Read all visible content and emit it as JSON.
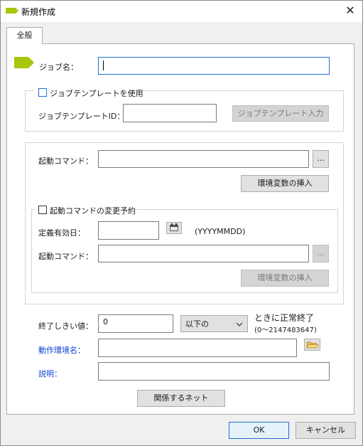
{
  "window": {
    "title": "新規作成",
    "close_symbol": "✕"
  },
  "tab": {
    "label": "全般"
  },
  "job_name": {
    "label": "ジョブ名：",
    "value": ""
  },
  "template": {
    "use_label": "ジョブテンプレートを使用",
    "id_label": "ジョブテンプレートID：",
    "id_value": "",
    "input_button": "ジョブテンプレート入力"
  },
  "start_command": {
    "label": "起動コマンド：",
    "value": "",
    "browse_label": "...",
    "insert_env_button": "環境変数の挿入"
  },
  "change_reservation": {
    "checkbox_label": "起動コマンドの変更予約",
    "date_label": "定義有効日：",
    "date_value": "",
    "date_format": "(YYYYMMDD)",
    "command_label": "起動コマンド：",
    "command_value": "",
    "browse_label": "...",
    "insert_env_button": "環境変数の挿入"
  },
  "end_threshold": {
    "label": "終了しきい値：",
    "value": "0",
    "condition_value": "以下の",
    "suffix": "ときに正常終了",
    "range": "(0〜2147483647)"
  },
  "environment": {
    "label": "動作環境名：",
    "value": ""
  },
  "description": {
    "label": "説明：",
    "value": ""
  },
  "related_net_button": "関係するネット",
  "footer": {
    "ok": "OK",
    "cancel": "キャンセル"
  },
  "colors": {
    "accent": "#a6c70c",
    "link": "#0a3fd6",
    "focus": "#1e6fd0"
  }
}
